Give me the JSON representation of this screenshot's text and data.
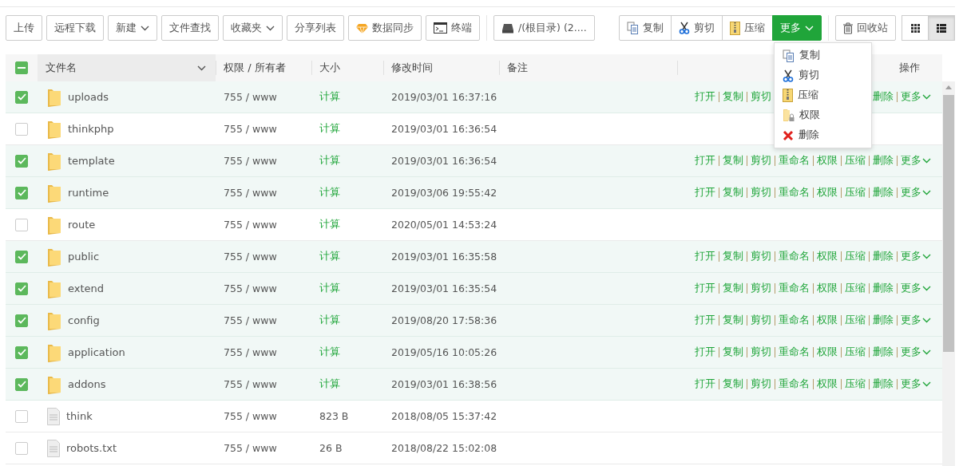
{
  "toolbar": {
    "buttons": [
      {
        "label": "上传",
        "kind": "plain"
      },
      {
        "label": "远程下载",
        "kind": "plain"
      },
      {
        "label": "新建",
        "kind": "dropdown"
      },
      {
        "label": "文件查找",
        "kind": "plain"
      },
      {
        "label": "收藏夹",
        "kind": "dropdown"
      },
      {
        "label": "分享列表",
        "kind": "plain"
      },
      {
        "label": "数据同步",
        "kind": "sync"
      },
      {
        "label": "终端",
        "kind": "terminal"
      }
    ],
    "path": "/(根目录) (2....",
    "batch": [
      {
        "label": "复制",
        "kind": "copy"
      },
      {
        "label": "剪切",
        "kind": "cut"
      },
      {
        "label": "压缩",
        "kind": "zip"
      }
    ],
    "more": "更多",
    "recycle": "回收站",
    "views": [
      {
        "kind": "grid",
        "selected": false
      },
      {
        "kind": "list",
        "selected": true
      }
    ]
  },
  "menu": {
    "items": [
      {
        "label": "复制",
        "kind": "copy"
      },
      {
        "label": "剪切",
        "kind": "cut"
      },
      {
        "label": "压缩",
        "kind": "zip"
      },
      {
        "label": "权限",
        "kind": "perm"
      },
      {
        "label": "删除",
        "kind": "delete"
      }
    ]
  },
  "table": {
    "select_all": {
      "indeterminate": true
    },
    "columns": [
      "文件名",
      "权限 / 所有者",
      "大小",
      "修改时间",
      "备注",
      "操作"
    ],
    "rows": [
      {
        "name": "uploads",
        "kind": "folder",
        "perms": "755 / www",
        "size": "计算",
        "mtime": "2019/03/01 16:37:16",
        "checked": true,
        "actions": [
          {
            "label": "打开",
            "after_gap": false
          },
          {
            "label": "复制",
            "after_gap": false
          },
          {
            "label": "剪切",
            "after_gap": false
          },
          {
            "label": "删除",
            "after_gap": true
          },
          {
            "label": "更多",
            "after_gap": false
          }
        ]
      },
      {
        "name": "thinkphp",
        "kind": "folder",
        "perms": "755 / www",
        "size": "计算",
        "mtime": "2019/03/01 16:36:54",
        "checked": false,
        "actions": []
      },
      {
        "name": "template",
        "kind": "folder",
        "perms": "755 / www",
        "size": "计算",
        "mtime": "2019/03/01 16:36:54",
        "checked": true,
        "actions": [
          {
            "label": "打开"
          },
          {
            "label": "复制"
          },
          {
            "label": "剪切"
          },
          {
            "label": "重命名"
          },
          {
            "label": "权限"
          },
          {
            "label": "压缩"
          },
          {
            "label": "删除"
          },
          {
            "label": "更多"
          }
        ]
      },
      {
        "name": "runtime",
        "kind": "folder",
        "perms": "755 / www",
        "size": "计算",
        "mtime": "2019/03/06 19:55:42",
        "checked": true,
        "actions": [
          {
            "label": "打开"
          },
          {
            "label": "复制"
          },
          {
            "label": "剪切"
          },
          {
            "label": "重命名"
          },
          {
            "label": "权限"
          },
          {
            "label": "压缩"
          },
          {
            "label": "删除"
          },
          {
            "label": "更多"
          }
        ]
      },
      {
        "name": "route",
        "kind": "folder",
        "perms": "755 / www",
        "size": "计算",
        "mtime": "2020/05/01 14:53:24",
        "checked": false,
        "actions": []
      },
      {
        "name": "public",
        "kind": "folder",
        "perms": "755 / www",
        "size": "计算",
        "mtime": "2019/03/01 16:35:58",
        "checked": true,
        "actions": [
          {
            "label": "打开"
          },
          {
            "label": "复制"
          },
          {
            "label": "剪切"
          },
          {
            "label": "重命名"
          },
          {
            "label": "权限"
          },
          {
            "label": "压缩"
          },
          {
            "label": "删除"
          },
          {
            "label": "更多"
          }
        ]
      },
      {
        "name": "extend",
        "kind": "folder",
        "perms": "755 / www",
        "size": "计算",
        "mtime": "2019/03/01 16:35:54",
        "checked": true,
        "actions": [
          {
            "label": "打开"
          },
          {
            "label": "复制"
          },
          {
            "label": "剪切"
          },
          {
            "label": "重命名"
          },
          {
            "label": "权限"
          },
          {
            "label": "压缩"
          },
          {
            "label": "删除"
          },
          {
            "label": "更多"
          }
        ]
      },
      {
        "name": "config",
        "kind": "folder",
        "perms": "755 / www",
        "size": "计算",
        "mtime": "2019/08/20 17:58:36",
        "checked": true,
        "actions": [
          {
            "label": "打开"
          },
          {
            "label": "复制"
          },
          {
            "label": "剪切"
          },
          {
            "label": "重命名"
          },
          {
            "label": "权限"
          },
          {
            "label": "压缩"
          },
          {
            "label": "删除"
          },
          {
            "label": "更多"
          }
        ]
      },
      {
        "name": "application",
        "kind": "folder",
        "perms": "755 / www",
        "size": "计算",
        "mtime": "2019/05/16 10:05:26",
        "checked": true,
        "actions": [
          {
            "label": "打开"
          },
          {
            "label": "复制"
          },
          {
            "label": "剪切"
          },
          {
            "label": "重命名"
          },
          {
            "label": "权限"
          },
          {
            "label": "压缩"
          },
          {
            "label": "删除"
          },
          {
            "label": "更多"
          }
        ]
      },
      {
        "name": "addons",
        "kind": "folder",
        "perms": "755 / www",
        "size": "计算",
        "mtime": "2019/03/01 16:38:56",
        "checked": true,
        "actions": [
          {
            "label": "打开"
          },
          {
            "label": "复制"
          },
          {
            "label": "剪切"
          },
          {
            "label": "重命名"
          },
          {
            "label": "权限"
          },
          {
            "label": "压缩"
          },
          {
            "label": "删除"
          },
          {
            "label": "更多"
          }
        ]
      },
      {
        "name": "think",
        "kind": "file",
        "perms": "755 / www",
        "size": "823 B",
        "mtime": "2018/08/05 15:37:42",
        "checked": false,
        "actions": []
      },
      {
        "name": "robots.txt",
        "kind": "file",
        "perms": "755 / www",
        "size": "26 B",
        "mtime": "2018/08/22 15:02:08",
        "checked": false,
        "actions": []
      }
    ]
  }
}
